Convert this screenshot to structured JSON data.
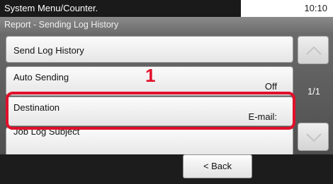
{
  "header": {
    "title": "System Menu/Counter.",
    "time": "10:10",
    "subtitle": "Report - Sending Log History"
  },
  "list": {
    "items": [
      {
        "label": "Send Log History",
        "value": ""
      },
      {
        "label": "Auto Sending",
        "value": "Off"
      },
      {
        "label": "Destination",
        "value": "E-mail:"
      },
      {
        "label": "Job Log Subject",
        "value": ""
      }
    ]
  },
  "pager": {
    "page": "1/1"
  },
  "annotation": {
    "step": "1"
  },
  "footer": {
    "back_label": "< Back"
  },
  "colors": {
    "highlight": "#e0102a",
    "title_bar": "#1a1a1a",
    "subtitle_bar": "#7c7c7c",
    "panel": "#5a5a5a"
  }
}
